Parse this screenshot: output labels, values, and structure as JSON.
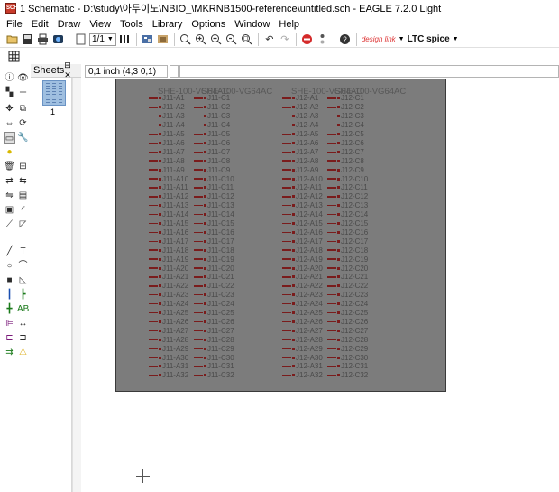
{
  "window": {
    "title": "1 Schematic - D:\\study\\아두이노\\NBIO_\\MKRNB1500-reference\\untitled.sch - EAGLE 7.2.0 Light",
    "icon_text": "SCH"
  },
  "menu": [
    "File",
    "Edit",
    "Draw",
    "View",
    "Tools",
    "Library",
    "Options",
    "Window",
    "Help"
  ],
  "toolbar": {
    "zoom_value": "1/1",
    "designlink_text": "design link",
    "ltc_text": "LTC spice",
    "icons": [
      "open-icon",
      "save-icon",
      "print-icon",
      "cam-icon",
      "zoom-select",
      "layers-icon",
      "board-icon",
      "library-icon",
      "zoom-fit-icon",
      "zoom-in-icon",
      "zoom-out-icon",
      "zoom-redraw-icon",
      "zoom-select-icon",
      "undo-icon",
      "redo-icon",
      "stop-icon",
      "go-icon",
      "help-icon"
    ]
  },
  "sheets": {
    "label": "Sheets",
    "items": [
      {
        "number": "1"
      }
    ]
  },
  "status": {
    "coordinates": "0,1 inch (4,3 0,1)",
    "command": ""
  },
  "schematic": {
    "parts": [
      {
        "name": "SHE-100-VG64AC",
        "left_prefix": "J11-A",
        "right_prefix": "J11-C"
      },
      {
        "name": "SHE-100-VG64AC",
        "left_prefix": "J12-A",
        "right_prefix": "J12-C"
      }
    ],
    "pin_count": 32,
    "colors": {
      "sheet": "#7c7c7c",
      "wire": "#7a1c1c",
      "pin_text": "#4a4a4a",
      "part_text": "#585858"
    }
  }
}
